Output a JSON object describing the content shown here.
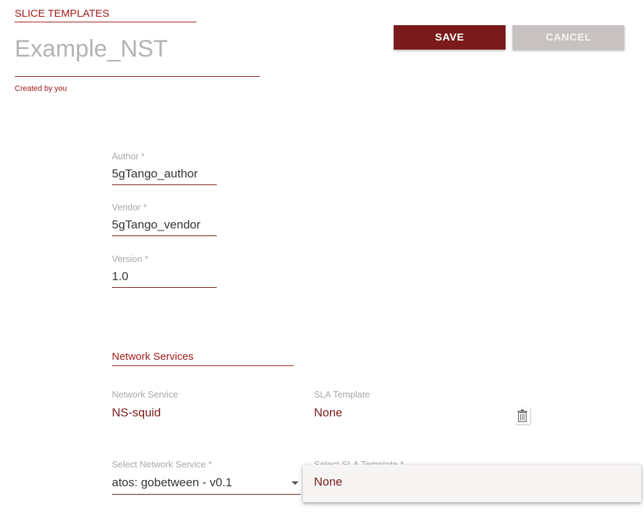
{
  "header": {
    "section_title": "SLICE TEMPLATES",
    "nst_name": "Example_NST",
    "created_by": "Created by you"
  },
  "actions": {
    "save_label": "SAVE",
    "cancel_label": "CANCEL"
  },
  "fields": {
    "author": {
      "label": "Author *",
      "value": "5gTango_author"
    },
    "vendor": {
      "label": "Vendor *",
      "value": "5gTango_vendor"
    },
    "version": {
      "label": "Version *",
      "value": "1.0"
    }
  },
  "network_services": {
    "title": "Network Services",
    "columns": {
      "ns_label": "Network Service",
      "sla_label": "SLA Template"
    },
    "entries": [
      {
        "network_service": "NS-squid",
        "sla_template": "None"
      }
    ],
    "select_ns": {
      "label": "Select Network Service *",
      "value": "atos: gobetween - v0.1"
    },
    "select_sla": {
      "label": "Select SLA Template *",
      "options": [
        "None"
      ]
    }
  },
  "icons": {
    "delete": "trash-icon",
    "dropdown": "chevron-down-icon"
  },
  "colors": {
    "accent": "#a31a1a",
    "primary_button": "#7a1a1a",
    "cancel_button": "#c7c1c1"
  }
}
